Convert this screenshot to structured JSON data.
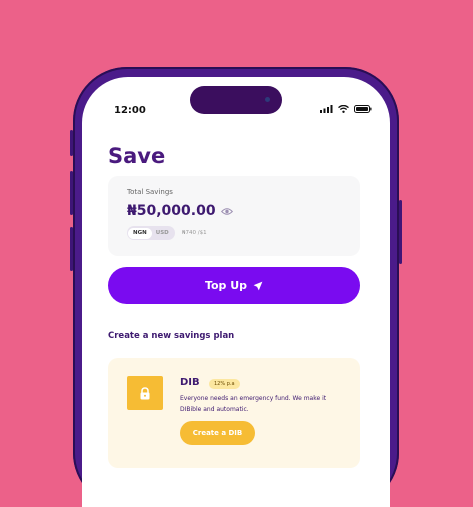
{
  "status_bar": {
    "time": "12:00"
  },
  "page": {
    "title": "Save"
  },
  "savings_card": {
    "label": "Total Savings",
    "amount": "₦50,000.00",
    "currency_toggle": {
      "selected": "NGN",
      "other": "USD"
    },
    "exchange_rate": "₦740 /$1"
  },
  "top_up": {
    "label": "Top Up"
  },
  "section": {
    "title": "Create a new savings plan"
  },
  "plan": {
    "name": "DIB",
    "badge": "12% p.a",
    "description": "Everyone needs an emergency fund. We make it DIBible and automatic.",
    "button_label": "Create a DIB"
  },
  "colors": {
    "background": "#EC6189",
    "phone_frame": "#4B1B8A",
    "primary": "#7A0BF0",
    "heading": "#4A1A7E",
    "accent_yellow": "#F6BC34",
    "plan_card_bg": "#FEF7E6"
  },
  "icons": [
    "eye-icon",
    "send-icon",
    "lock-icon",
    "signal-icon",
    "wifi-icon",
    "battery-icon"
  ]
}
